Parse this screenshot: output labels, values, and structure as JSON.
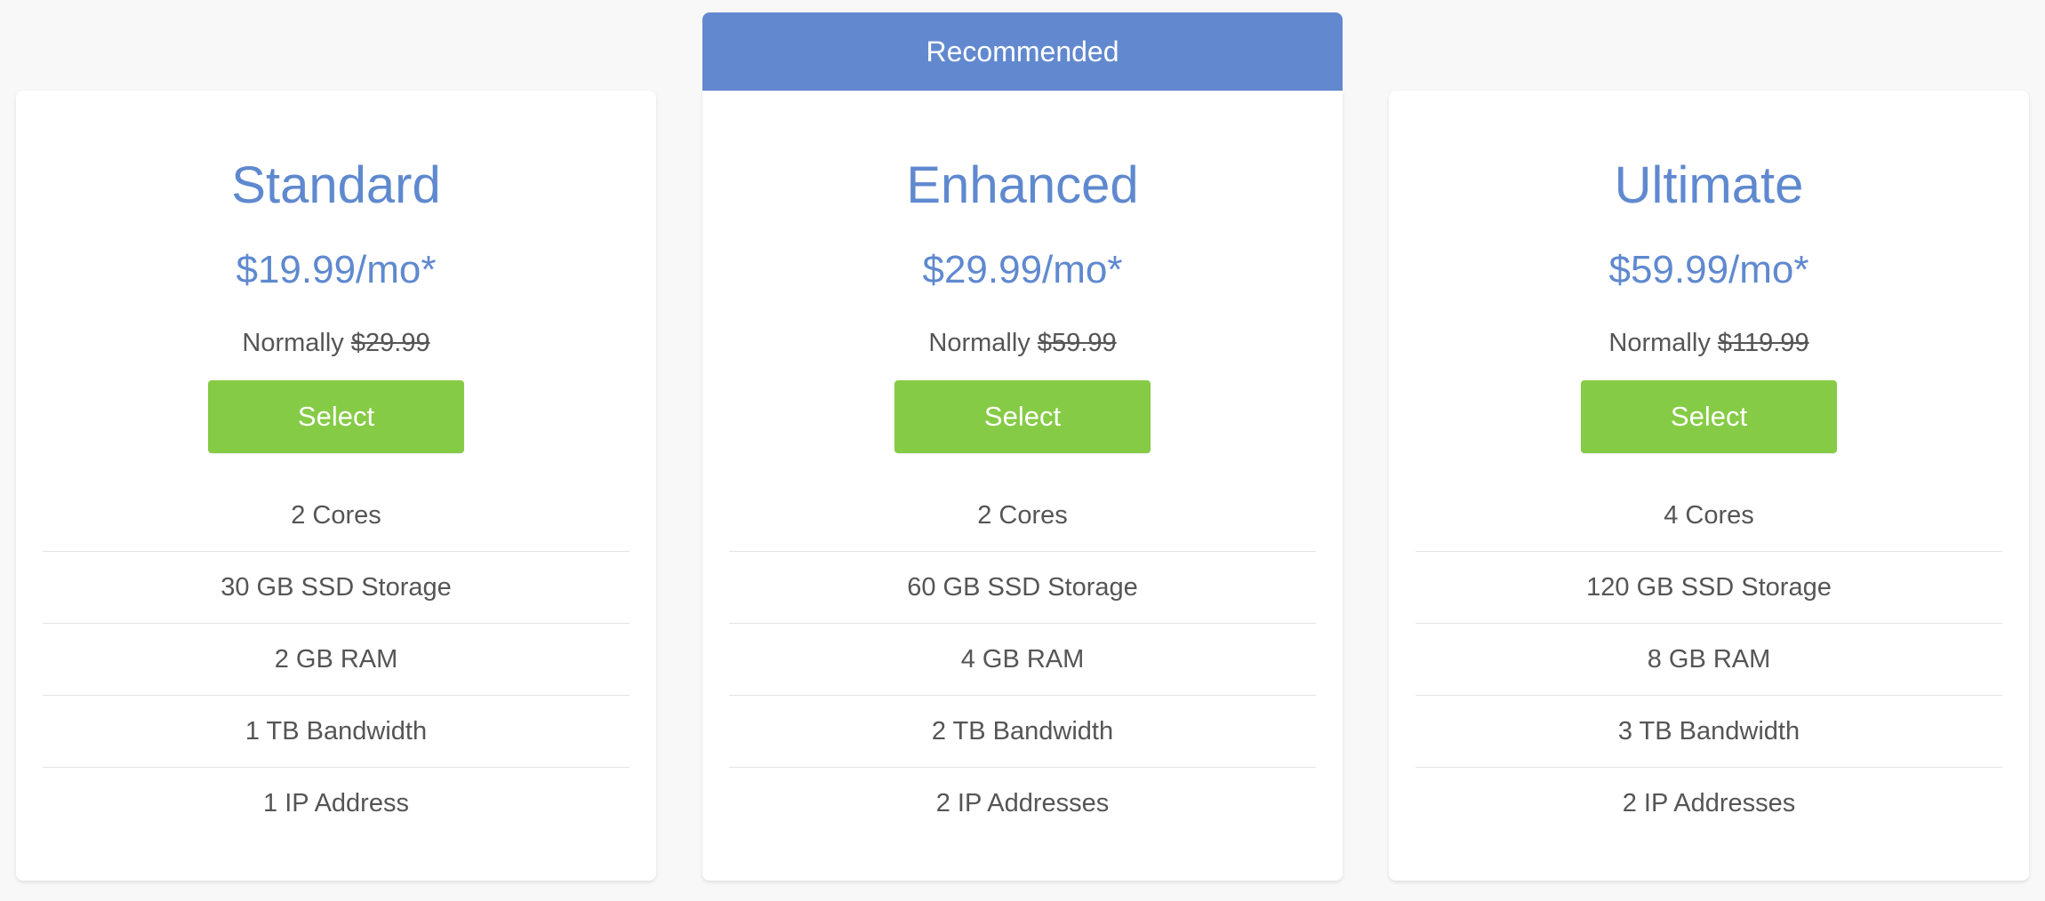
{
  "colors": {
    "accent": "#5f89cf",
    "ribbon_bg": "#6289cf",
    "button_bg": "#86cb46",
    "text": "#555555",
    "page_bg": "#f8f8f8"
  },
  "ribbon": {
    "label": "Recommended"
  },
  "plans": [
    {
      "name": "Standard",
      "price": "$19.99/mo*",
      "normally_label": "Normally",
      "normal_price": "$29.99",
      "button_label": "Select",
      "features": [
        "2 Cores",
        "30 GB SSD Storage",
        "2 GB RAM",
        "1 TB Bandwidth",
        "1 IP Address"
      ]
    },
    {
      "name": "Enhanced",
      "price": "$29.99/mo*",
      "normally_label": "Normally",
      "normal_price": "$59.99",
      "button_label": "Select",
      "features": [
        "2 Cores",
        "60 GB SSD Storage",
        "4 GB RAM",
        "2 TB Bandwidth",
        "2 IP Addresses"
      ]
    },
    {
      "name": "Ultimate",
      "price": "$59.99/mo*",
      "normally_label": "Normally",
      "normal_price": "$119.99",
      "button_label": "Select",
      "features": [
        "4 Cores",
        "120 GB SSD Storage",
        "8 GB RAM",
        "3 TB Bandwidth",
        "2 IP Addresses"
      ]
    }
  ]
}
